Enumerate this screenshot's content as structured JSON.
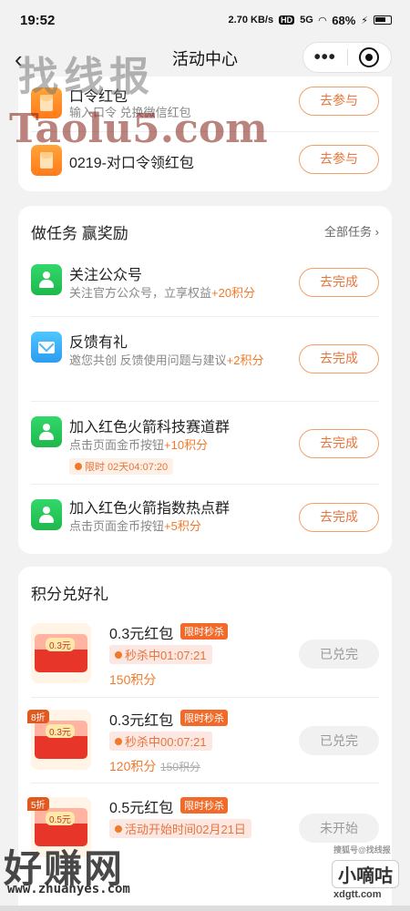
{
  "status_bar": {
    "time": "19:52",
    "net_speed": "2.70 KB/s",
    "hd": "HD",
    "signal": "5G",
    "battery": "68%"
  },
  "nav": {
    "title": "活动中心",
    "more": "•••"
  },
  "redpacket_rows": [
    {
      "title": "口令红包",
      "subtitle": "输入口令 兑换微信红包",
      "button": "去参与"
    },
    {
      "title": "0219-对口令领红包",
      "button": "去参与"
    }
  ],
  "tasks": {
    "title": "做任务 赢奖励",
    "all_link": "全部任务",
    "items": [
      {
        "title": "关注公众号",
        "desc": "关注官方公众号，立享权益",
        "points": "+20积分",
        "button": "去完成"
      },
      {
        "title": "反馈有礼",
        "desc": "邀您共创 反馈使用问题与建议",
        "points": "+2积分",
        "button": "去完成"
      },
      {
        "title": "加入红色火箭科技赛道群",
        "desc": "点击页面金币按钮",
        "points": "+10积分",
        "limit": "限时 02天04:07:20",
        "button": "去完成"
      },
      {
        "title": "加入红色火箭指数热点群",
        "desc": "点击页面金币按钮",
        "points": "+5积分",
        "button": "去完成"
      }
    ]
  },
  "exchange": {
    "title": "积分兑好礼",
    "items": [
      {
        "name": "0.3元红包",
        "flash": "限时秒杀",
        "thumb_label": "0.3元",
        "countdown": "秒杀中01:07:21",
        "points": "150积分",
        "status": "已兑完"
      },
      {
        "name": "0.3元红包",
        "flash": "限时秒杀",
        "thumb_label": "0.3元",
        "discount": "8折",
        "countdown": "秒杀中00:07:21",
        "points": "120积分",
        "original_points": "150积分",
        "status": "已兑完"
      },
      {
        "name": "0.5元红包",
        "flash": "限时秒杀",
        "thumb_label": "0.5元",
        "discount": "5折",
        "countdown": "活动开始时间02月21日",
        "status": "未开始"
      }
    ]
  },
  "watermarks": {
    "top_text": "找线报",
    "top_url": "Taolu5.com",
    "bottom_text": "好赚网",
    "bottom_url": "www.zhuanyes.com",
    "corner_small": "搜狐号@找线报",
    "corner_logo": "小嘀咕",
    "corner_url": "xdgtt.com"
  }
}
